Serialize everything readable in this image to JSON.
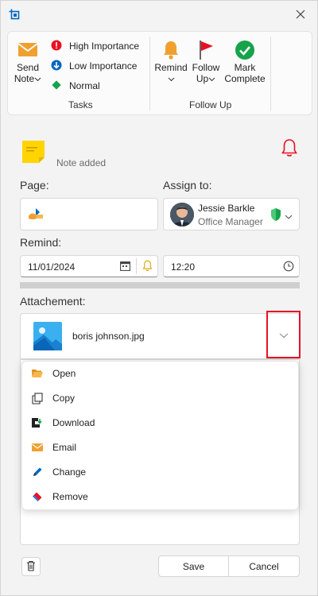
{
  "window": {
    "close_icon": "close-icon",
    "app_icon": "screen-clip-icon"
  },
  "ribbon": {
    "send_note": {
      "line1": "Send",
      "line2": "Note"
    },
    "importance": [
      {
        "label": "High Importance",
        "icon": "high-importance-icon",
        "color": "#e81123"
      },
      {
        "label": "Low Importance",
        "icon": "low-importance-icon",
        "color": "#0067c0"
      },
      {
        "label": "Normal",
        "icon": "normal-importance-icon",
        "color": "#16a34a"
      }
    ],
    "tasks_label": "Tasks",
    "remind": {
      "line1": "Remind"
    },
    "follow_up": {
      "line1": "Follow",
      "line2": "Up"
    },
    "mark_complete": {
      "line1": "Mark",
      "line2": "Complete"
    },
    "follow_up_label": "Follow Up"
  },
  "note": {
    "status": "Note added"
  },
  "page": {
    "label": "Page:"
  },
  "assign": {
    "label": "Assign to:",
    "name": "Jessie Barkle",
    "role": "Office Manager"
  },
  "remind": {
    "label": "Remind:",
    "date": "11/01/2024",
    "time": "12:20"
  },
  "attachment": {
    "label": "Attachement:",
    "file_name": "boris johnson.jpg"
  },
  "menu": {
    "items": [
      {
        "label": "Open",
        "icon": "folder-open-icon"
      },
      {
        "label": "Copy",
        "icon": "copy-icon"
      },
      {
        "label": "Download",
        "icon": "download-icon"
      },
      {
        "label": "Email",
        "icon": "email-icon"
      },
      {
        "label": "Change",
        "icon": "pencil-icon"
      },
      {
        "label": "Remove",
        "icon": "eraser-icon"
      }
    ]
  },
  "footer": {
    "save": "Save",
    "cancel": "Cancel"
  },
  "colors": {
    "highlight": "#e81123",
    "accent": "#0067c0",
    "orange": "#f0a030"
  }
}
